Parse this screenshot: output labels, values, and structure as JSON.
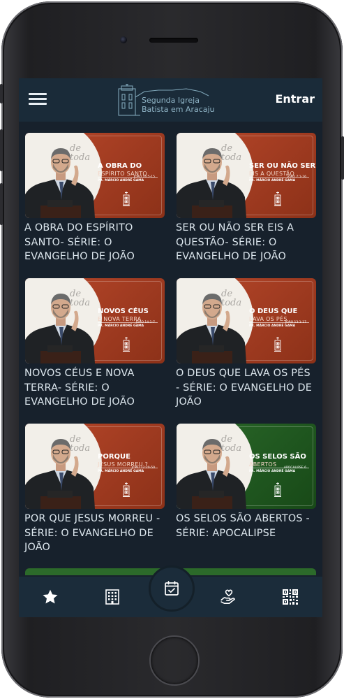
{
  "header": {
    "logo_line1": "Segunda Igreja",
    "logo_line2": "Batista em Aracaju",
    "login_label": "Entrar"
  },
  "sermons": [
    {
      "title": "A OBRA DO ESPÍRITO SANTO- SÉRIE: O EVANGELHO DE JOÃO",
      "thumb_title": "A OBRA DO",
      "thumb_subtitle": "ESPÍRITO SANTO",
      "thumb_ref": "JOÃO 16:5-15",
      "theme": "red"
    },
    {
      "title": "SER OU NÃO SER EIS A QUESTÃO- SÉRIE: O EVANGELHO DE JOÃO",
      "thumb_title": "SER OU NÃO SER?",
      "thumb_subtitle": "EIS A QUESTÃO",
      "thumb_ref": "JOÃO 7:1-16",
      "theme": "red"
    },
    {
      "title": "NOVOS CÉUS E NOVA TERRA- SÉRIE: O EVANGELHO DE JOÃO",
      "thumb_title": "NOVOS CÉUS",
      "thumb_subtitle": "E NOVA TERRA",
      "thumb_ref": "JOÃO 14:1-7",
      "theme": "red"
    },
    {
      "title": "O DEUS QUE LAVA OS PÉS - SÉRIE: O EVANGELHO DE JOÃO",
      "thumb_title": "O DEUS QUE",
      "thumb_subtitle": "LAVA OS PÉS",
      "thumb_ref": "JOÃO 13:1-17",
      "theme": "red"
    },
    {
      "title": "POR QUE JESUS MORREU - SÉRIE: O EVANGELHO DE JOÃO",
      "thumb_title": "PORQUE",
      "thumb_subtitle": "JESUS MORREU ?",
      "thumb_ref": "JOÃO 12:20-50",
      "theme": "red"
    },
    {
      "title": "OS SELOS SÃO ABERTOS - SÉRIE: APOCALIPSE",
      "thumb_title": "OS SELOS SÃO",
      "thumb_subtitle": "ABERTOS",
      "thumb_ref": "APOCALIPSE 6",
      "theme": "green"
    }
  ],
  "thumb_speaker": "PR. MÁRCIO ANDRÉ GAMA",
  "thumb_watermark": "de toda",
  "bottom_nav": {
    "items": [
      "star-icon",
      "building-icon",
      "calendar-check-icon",
      "helping-hand-icon",
      "qr-code-icon"
    ],
    "active": "calendar-check-icon"
  },
  "colors": {
    "background": "#17212c",
    "header": "#1a2b39",
    "text": "#dde7ee",
    "red_thumb": "#b9482a",
    "green_thumb": "#2c6a2a"
  }
}
